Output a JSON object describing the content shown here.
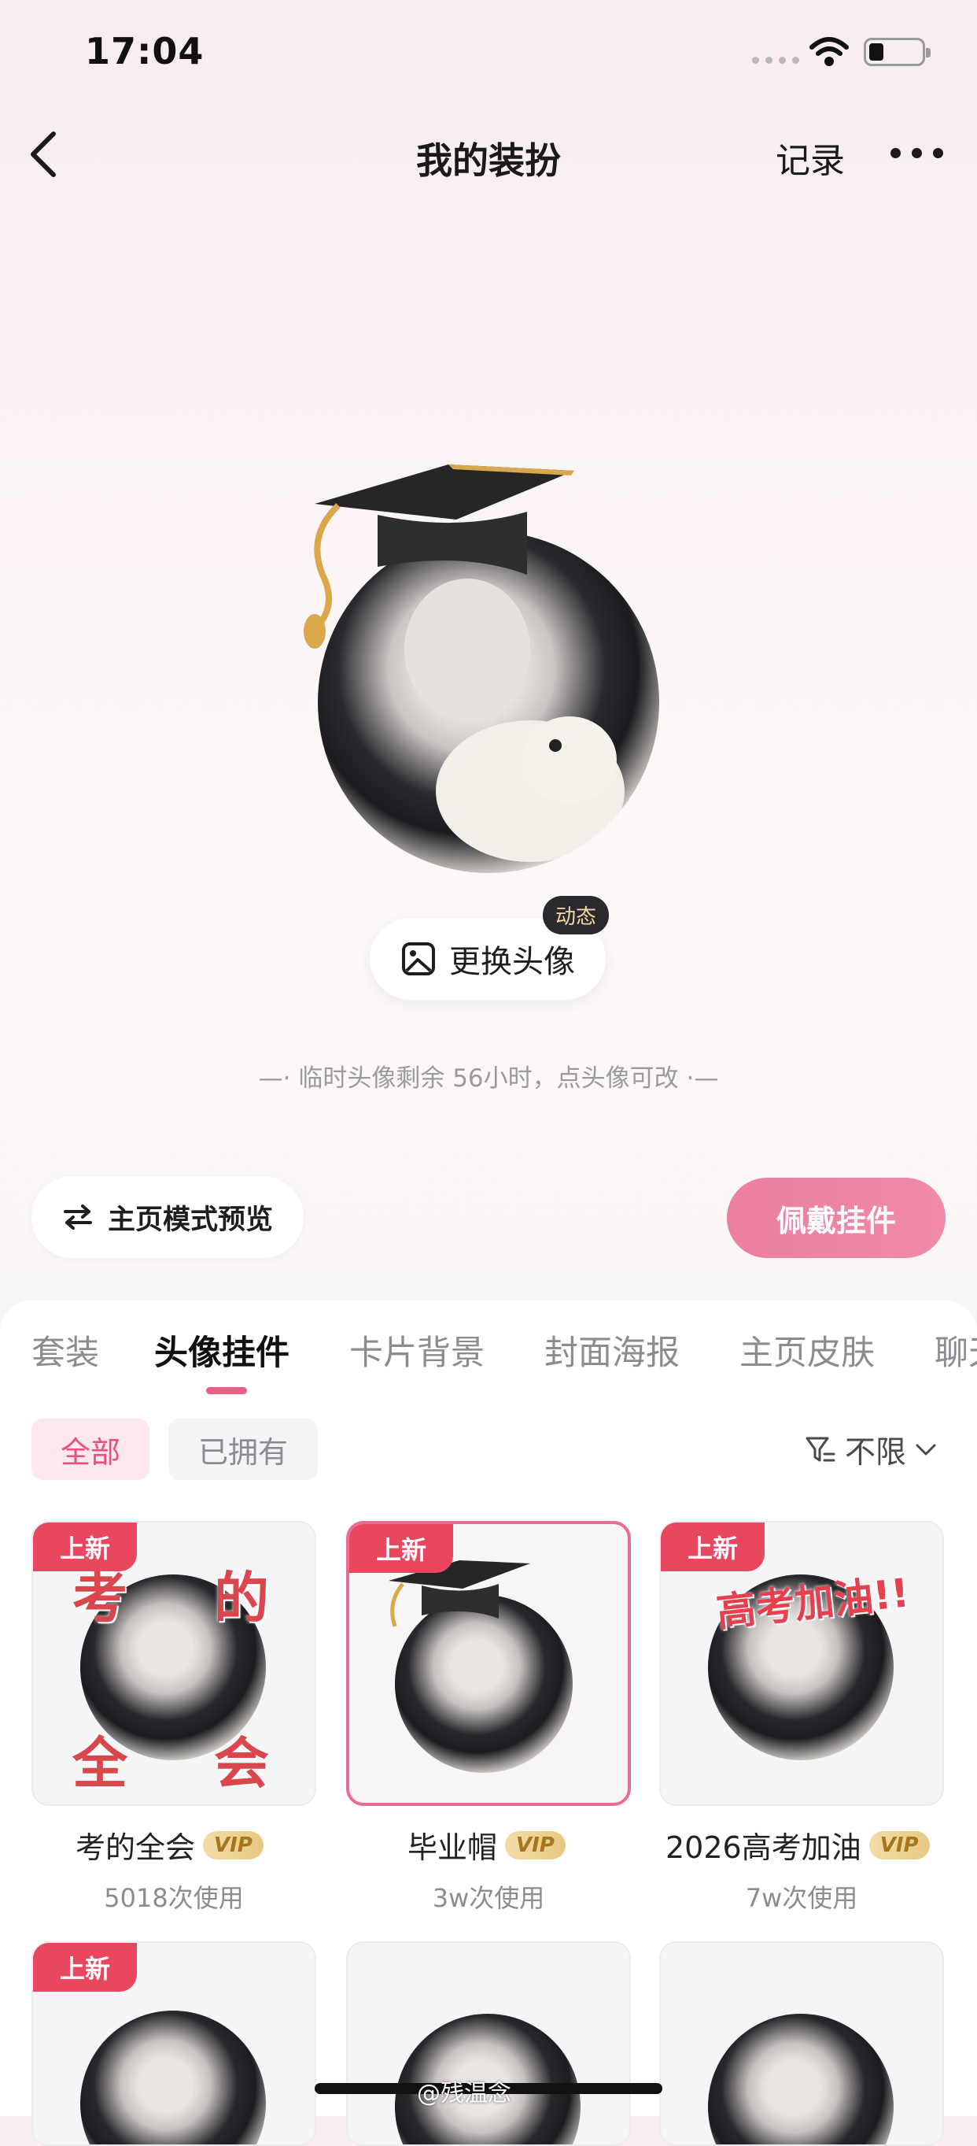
{
  "status_bar": {
    "time": "17:04"
  },
  "nav": {
    "title": "我的装扮",
    "records_label": "记录"
  },
  "avatar": {
    "change_label": "更换头像",
    "dynamic_badge": "动态",
    "hint": "—· 临时头像剩余 56小时，点头像可改 ·—"
  },
  "actions": {
    "preview_label": "主页模式预览",
    "wear_label": "佩戴挂件"
  },
  "tabs": [
    {
      "label": "套装",
      "active": false
    },
    {
      "label": "头像挂件",
      "active": true
    },
    {
      "label": "卡片背景",
      "active": false
    },
    {
      "label": "封面海报",
      "active": false
    },
    {
      "label": "主页皮肤",
      "active": false
    },
    {
      "label": "聊天",
      "active": false
    }
  ],
  "filters": {
    "all": "全部",
    "owned": "已拥有",
    "sort": "不限"
  },
  "items": [
    {
      "badge": "上新",
      "title": "考的全会",
      "vip": "VIP",
      "usage": "5018次使用",
      "deco": [
        "考",
        "的",
        "全",
        "会"
      ],
      "selected": false
    },
    {
      "badge": "上新",
      "title": "毕业帽",
      "vip": "VIP",
      "usage": "3w次使用",
      "selected": true
    },
    {
      "badge": "上新",
      "title": "2026高考加油",
      "vip": "VIP",
      "usage": "7w次使用",
      "deco_banner": "高考加油!!",
      "selected": false
    },
    {
      "badge": "上新"
    }
  ],
  "watermark": "@残温念",
  "colors": {
    "accent": "#ec5d88",
    "new_badge": "#e8475f",
    "wear_button": "#f08aa7"
  }
}
